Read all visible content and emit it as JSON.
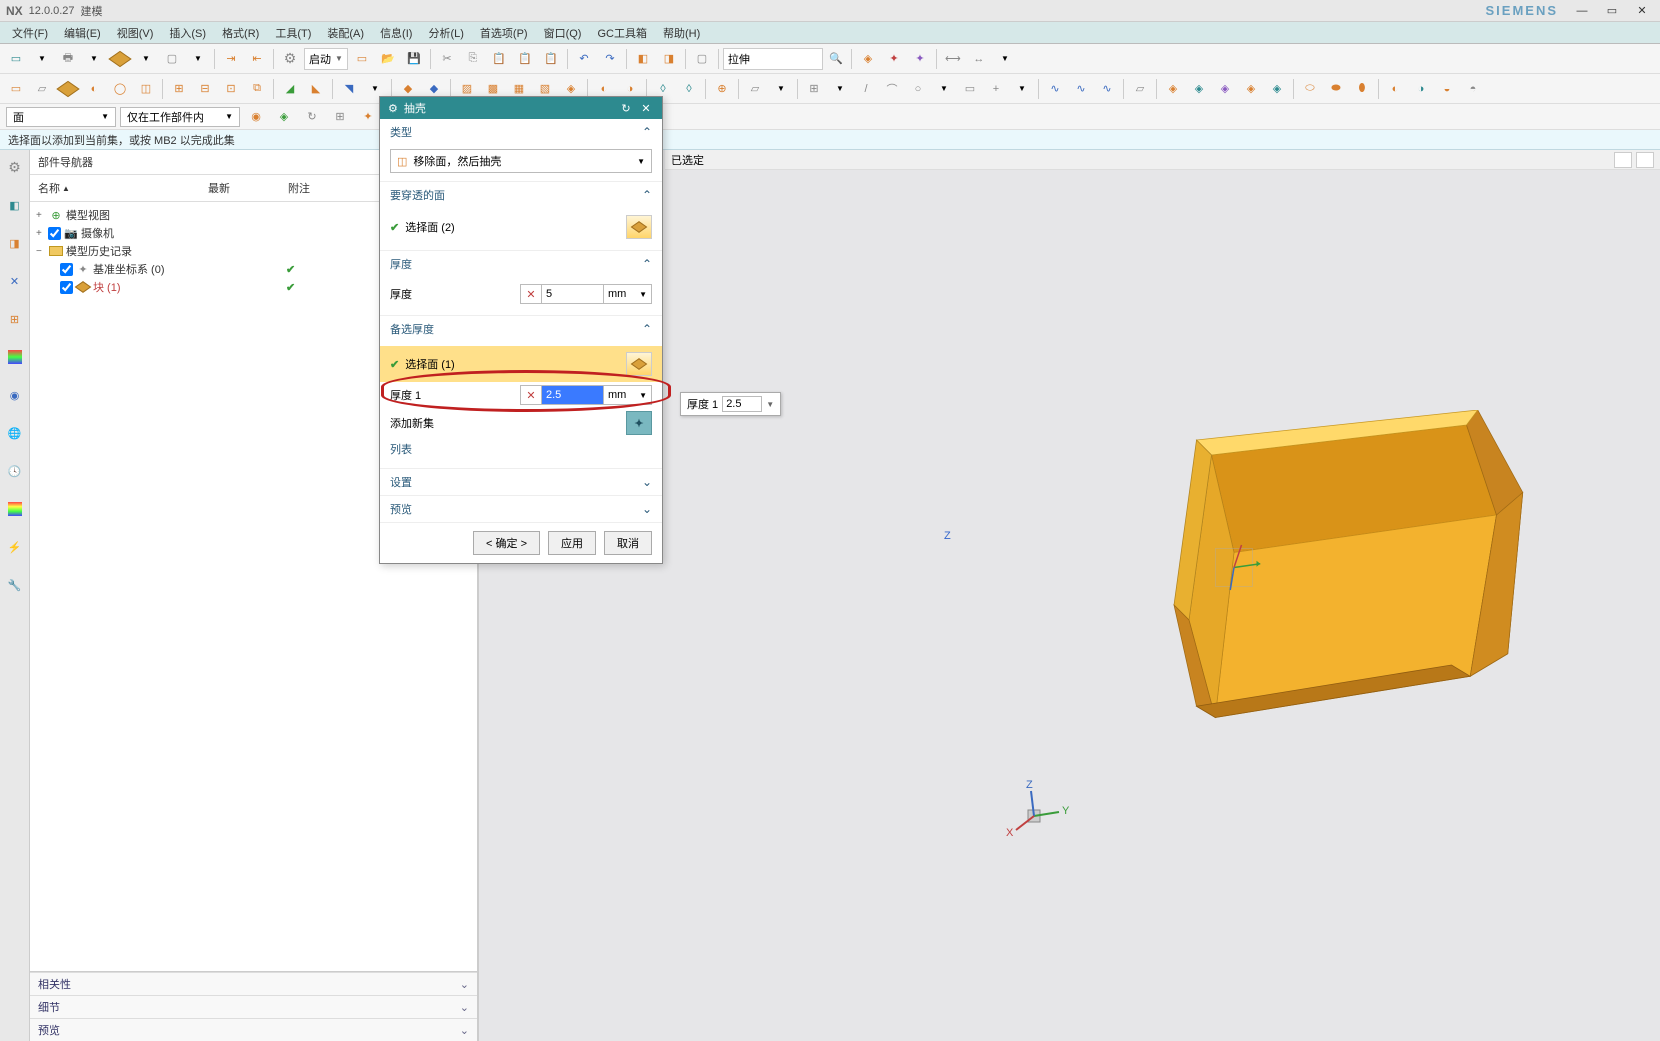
{
  "title": {
    "nx": "NX",
    "version": "12.0.0.27",
    "doc": "建模"
  },
  "siemens": "SIEMENS",
  "menu": {
    "file": "文件(F)",
    "edit": "编辑(E)",
    "view": "视图(V)",
    "insert": "插入(S)",
    "format": "格式(R)",
    "tools": "工具(T)",
    "assembly": "装配(A)",
    "info": "信息(I)",
    "analysis": "分析(L)",
    "prefs": "首选项(P)",
    "window": "窗口(Q)",
    "gctools": "GC工具箱",
    "help": "帮助(H)"
  },
  "toolbar1": {
    "start": "启动",
    "history_cmd": "拉伸"
  },
  "selbar": {
    "filter1": "面",
    "filter2": "仅在工作部件内"
  },
  "msg": "选择面以添加到当前集，或按 MB2 以完成此集",
  "viewport": {
    "selected": "已选定"
  },
  "nav": {
    "title": "部件导航器",
    "col_name": "名称",
    "col_latest": "最新",
    "col_notes": "附注",
    "tree": {
      "model_view": "模型视图",
      "camera": "摄像机",
      "history": "模型历史记录",
      "datum": "基准坐标系 (0)",
      "block": "块 (1)"
    },
    "bottom": {
      "dependency": "相关性",
      "detail": "细节",
      "preview": "预览"
    }
  },
  "dialog": {
    "title": "抽壳",
    "sec_type": "类型",
    "type_value": "移除面，然后抽壳",
    "sec_pierce": "要穿透的面",
    "select_face": "选择面 (2)",
    "sec_thickness": "厚度",
    "thickness_label": "厚度",
    "thickness_value": "5",
    "thickness_unit": "mm",
    "sec_alt": "备选厚度",
    "alt_select_face": "选择面 (1)",
    "alt_thk_label": "厚度 1",
    "alt_thk_value": "2.5",
    "alt_thk_unit": "mm",
    "add_new": "添加新集",
    "list": "列表",
    "sec_settings": "设置",
    "sec_preview": "预览",
    "btn_ok": "< 确定 >",
    "btn_apply": "应用",
    "btn_cancel": "取消"
  },
  "floating": {
    "label": "厚度 1",
    "value": "2.5"
  },
  "axes": {
    "z": "Z",
    "y": "Y",
    "x": "X"
  }
}
